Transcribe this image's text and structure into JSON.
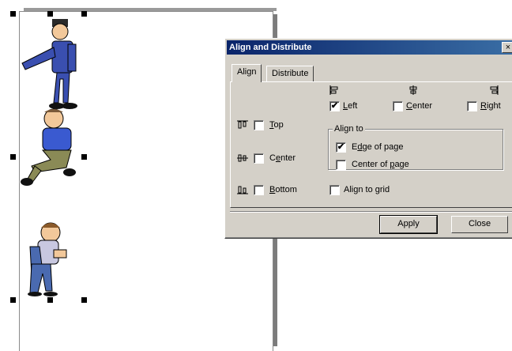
{
  "dialog": {
    "title": "Align and Distribute",
    "close_glyph": "×",
    "tabs": [
      {
        "label": "Align",
        "active": true
      },
      {
        "label": "Distribute",
        "active": false
      }
    ],
    "horizontal": [
      {
        "label": "Left",
        "accel": "L",
        "checked": true,
        "icon": "align-left-icon"
      },
      {
        "label": "Center",
        "accel": "C",
        "checked": false,
        "icon": "align-center-h-icon"
      },
      {
        "label": "Right",
        "accel": "R",
        "checked": false,
        "icon": "align-right-icon"
      }
    ],
    "vertical": [
      {
        "label": "Top",
        "accel": "T",
        "checked": false,
        "icon": "align-top-icon"
      },
      {
        "label": "Center",
        "accel": "e",
        "checked": false,
        "icon": "align-center-v-icon"
      },
      {
        "label": "Bottom",
        "accel": "B",
        "checked": false,
        "icon": "align-bottom-icon"
      }
    ],
    "align_to": {
      "group_label": "Align to",
      "edge_of_page": {
        "label": "Edge of page",
        "accel": "d",
        "checked": true
      },
      "center_of_page": {
        "label": "Center of page",
        "accel": "p",
        "checked": false
      }
    },
    "align_to_grid": {
      "label": "Align to grid",
      "checked": false
    },
    "buttons": {
      "apply": "Apply",
      "close": "Close"
    }
  },
  "canvas": {
    "clipart": [
      "businessman-pointing-clipart",
      "man-sitting-clipart",
      "man-bending-clipart"
    ],
    "selection_handles": true
  },
  "colors": {
    "titlebar_start": "#0a246a",
    "titlebar_end": "#3a6ea5",
    "dialog_face": "#d4d0c8"
  }
}
